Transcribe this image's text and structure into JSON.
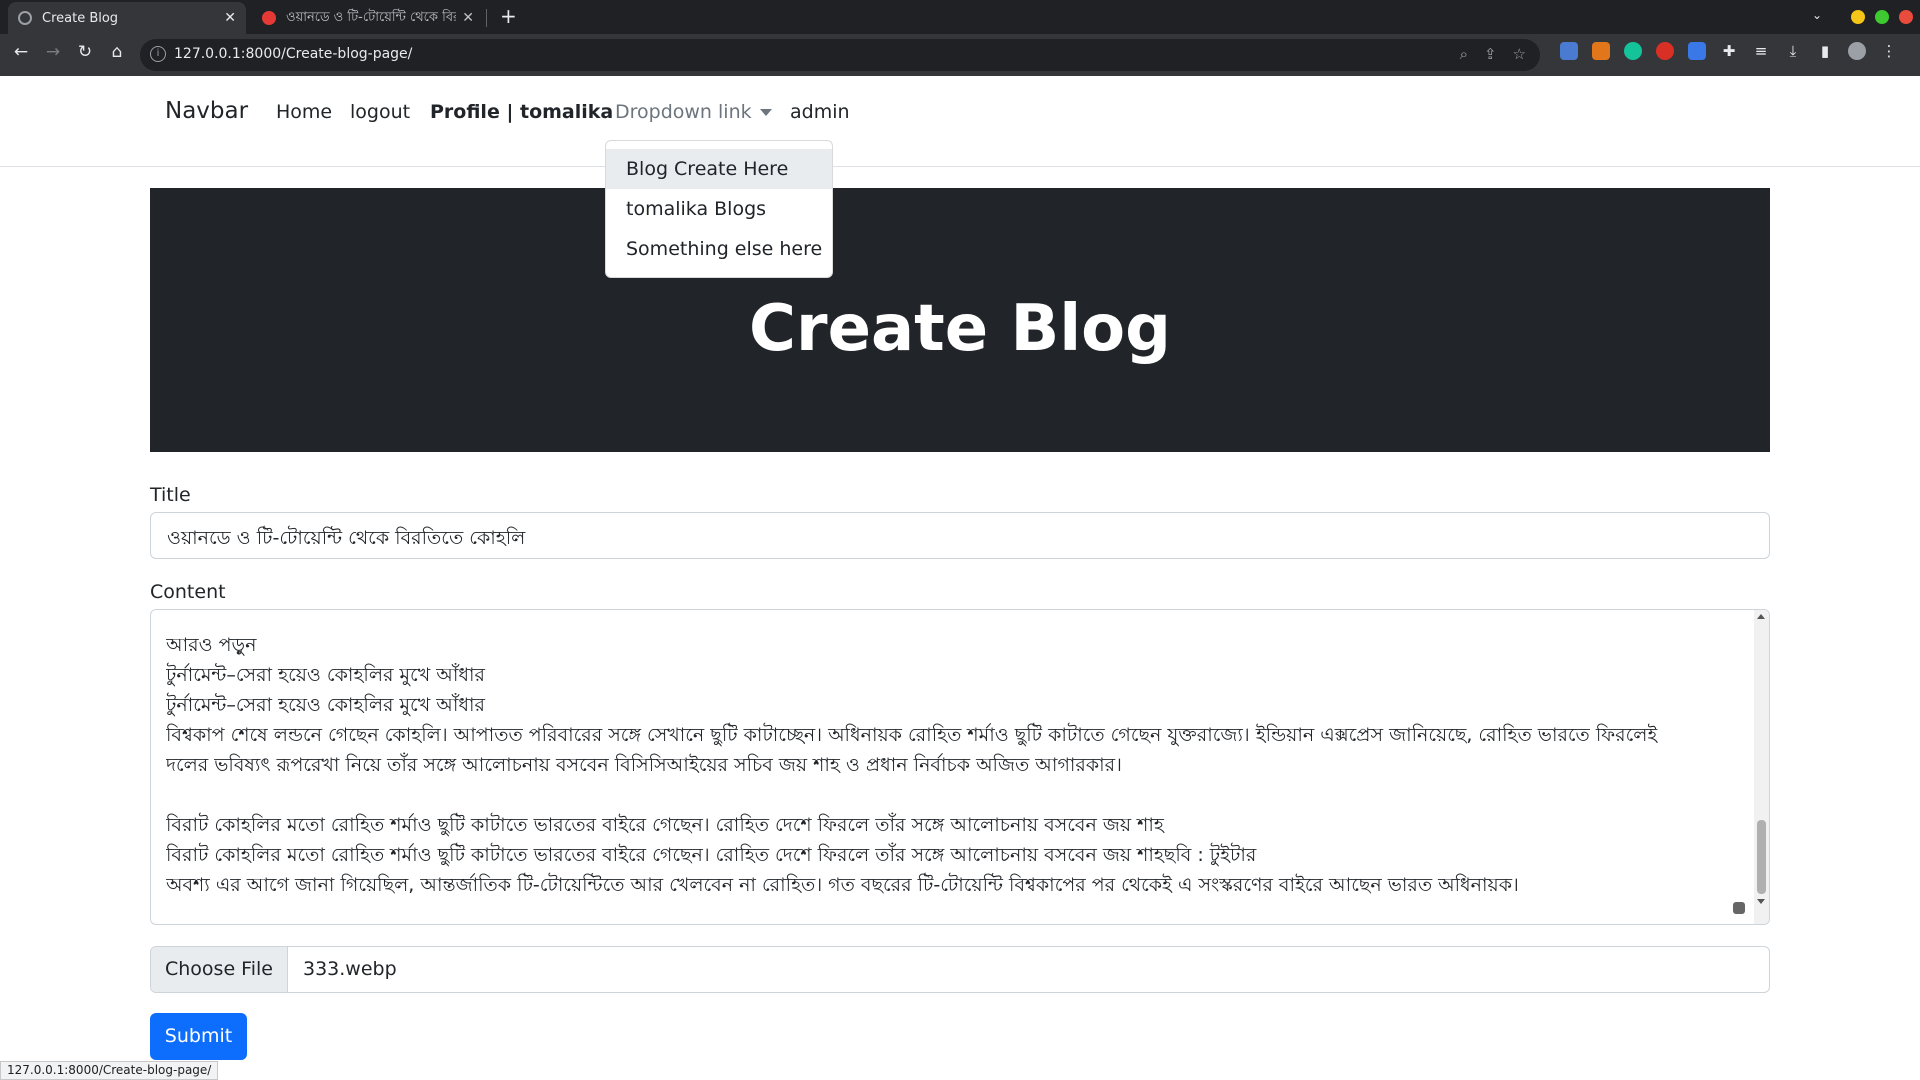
{
  "browser": {
    "tabs": [
      {
        "title": "Create Blog",
        "active": true
      },
      {
        "title": "ওয়ানডে ও টি-টোয়েন্টি থেকে বির",
        "active": false
      }
    ],
    "tab_close": "✕",
    "new_tab": "+",
    "url": "127.0.0.1:8000/Create-blog-page/",
    "window_controls": {
      "minimize": "#f5c518",
      "maximize": "#3ec930",
      "close": "#e94b3c"
    }
  },
  "navbar": {
    "brand": "Navbar",
    "links": [
      "Home",
      "logout",
      "Profile | tomalika",
      "Dropdown link",
      "admin"
    ]
  },
  "dropdown": {
    "items": [
      "Blog Create Here",
      "tomalika Blogs",
      "Something else here"
    ]
  },
  "hero": {
    "title": "Create Blog"
  },
  "form": {
    "title_label": "Title",
    "title_value": "ওয়ানডে ও টি-টোয়েন্টি থেকে বিরতিতে কোহলি",
    "content_label": "Content",
    "content_lines": [
      "",
      "আরও পড়ুন",
      "টুর্নামেন্ট–সেরা হয়েও কোহলির মুখে আঁধার",
      "টুর্নামেন্ট–সেরা হয়েও কোহলির মুখে আঁধার",
      "বিশ্বকাপ শেষে লন্ডনে গেছেন কোহলি। আপাতত পরিবারের সঙ্গে সেখানে ছুটি কাটাচ্ছেন। অধিনায়ক রোহিত শর্মাও ছুটি কাটাতে গেছেন যুক্তরাজ্যে। ইন্ডিয়ান এক্সপ্রেস জানিয়েছে, রোহিত ভারতে ফিরলেই",
      "দলের ভবিষ্যৎ রূপরেখা নিয়ে তাঁর সঙ্গে আলোচনায় বসবেন বিসিসিআইয়ের সচিব জয় শাহ ও প্রধান নির্বাচক অজিত আগারকার।",
      "",
      "বিরাট কোহলির মতো রোহিত শর্মাও ছুটি কাটাতে ভারতের বাইরে গেছেন। রোহিত দেশে ফিরলে তাঁর সঙ্গে আলোচনায় বসবেন জয় শাহ",
      "বিরাট কোহলির মতো রোহিত শর্মাও ছুটি কাটাতে ভারতের বাইরে গেছেন। রোহিত দেশে ফিরলে তাঁর সঙ্গে আলোচনায় বসবেন জয় শাহছবি : টুইটার",
      "অবশ্য এর আগে জানা গিয়েছিল, আন্তর্জাতিক টি-টোয়েন্টিতে আর খেলবেন না রোহিত। গত বছরের টি-টোয়েন্টি বিশ্বকাপের পর থেকেই এ সংস্করণের বাইরে আছেন ভারত অধিনায়ক।"
    ],
    "file_button": "Choose File",
    "file_name": "333.webp",
    "submit": "Submit"
  },
  "status_bar": "127.0.0.1:8000/Create-blog-page/"
}
